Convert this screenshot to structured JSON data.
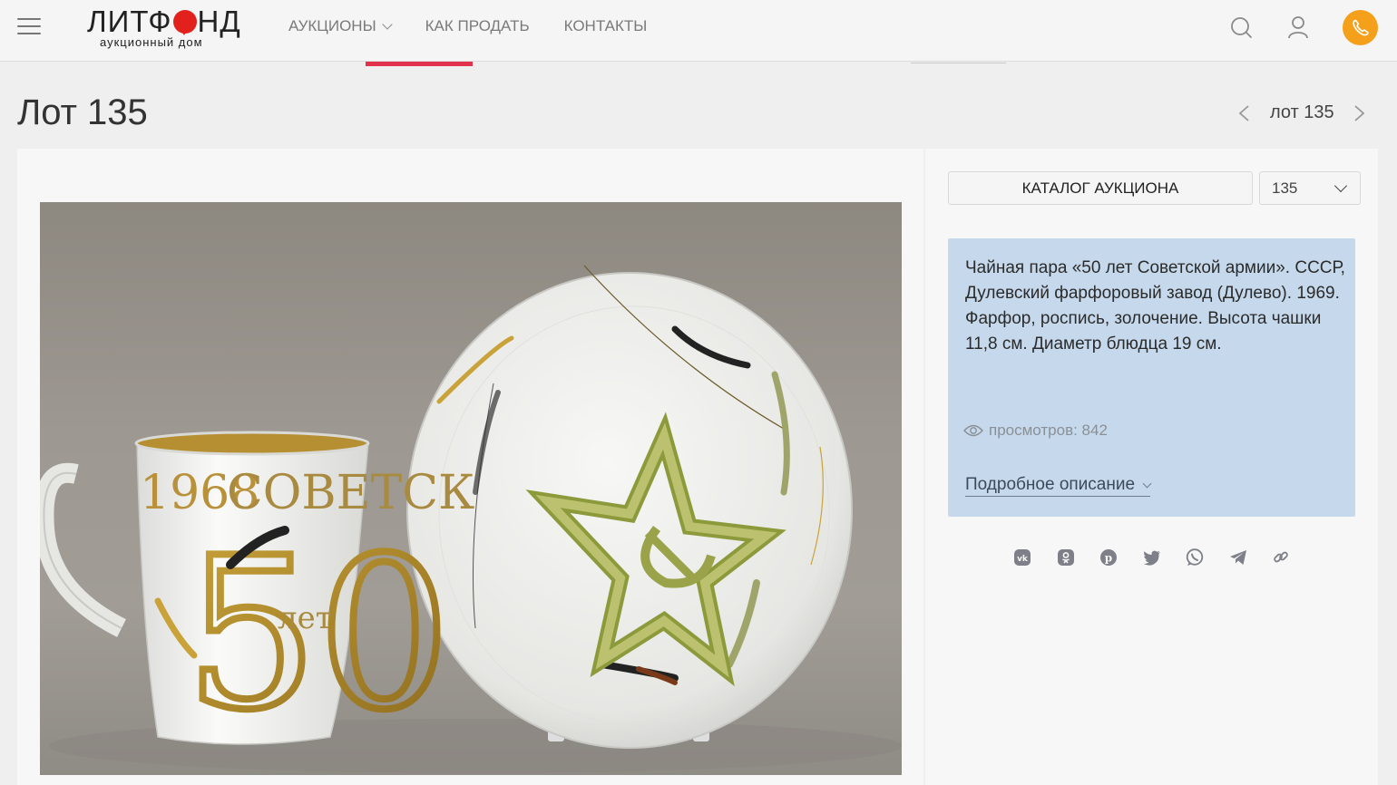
{
  "header": {
    "logo_text_left": "ЛИТФ",
    "logo_text_right": "НД",
    "logo_subtitle": "аукционный дом",
    "nav": [
      {
        "label": "АУКЦИОНЫ",
        "has_dropdown": true
      },
      {
        "label": "КАК ПРОДАТЬ",
        "has_dropdown": false
      },
      {
        "label": "КОНТАКТЫ",
        "has_dropdown": false
      }
    ],
    "icons": [
      "menu-icon",
      "search-icon",
      "user-icon",
      "phone-icon"
    ],
    "accent_color": "#f5a01a"
  },
  "page": {
    "title": "Лот 135",
    "lot_nav_label": "лот 135"
  },
  "sidebar": {
    "catalog_button": "КАТАЛОГ АУКЦИОНА",
    "lot_select_value": "135",
    "description": "Чайная пара «50 лет Советской армии». СССР, Дулевский фарфоровый завод (Дулево). 1969. Фарфор, роспись, золочение. Высота чашки 11,8 см. Диаметр блюдца 19 см.",
    "views": "просмотров: 842",
    "more_link": "Подробное описание",
    "desc_bg": "#c6d9ec"
  },
  "share_icons": [
    "vk-icon",
    "odnoklassniki-icon",
    "pinterest-icon",
    "twitter-icon",
    "whatsapp-icon",
    "telegram-icon",
    "link-icon"
  ],
  "photo": {
    "cup_text_year": "1968",
    "cup_text_word": "СОВЕТСК",
    "cup_text_number": "50",
    "cup_text_years": "лет"
  }
}
